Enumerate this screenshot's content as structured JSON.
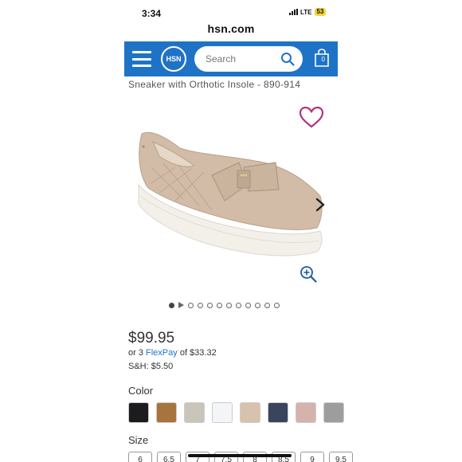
{
  "status": {
    "time": "3:34",
    "network": "LTE",
    "battery": "53"
  },
  "browser": {
    "url": "hsn.com"
  },
  "header": {
    "logo_text": "HSN",
    "search_placeholder": "Search",
    "bag_count": "0"
  },
  "product": {
    "title": "Sneaker with Orthotic Insole  - 890-914",
    "price": "$99.95",
    "flexpay_prefix": "or 3 ",
    "flexpay_link": "FlexPay",
    "flexpay_suffix": " of $33.32",
    "shipping": "S&H: $5.50"
  },
  "gallery": {
    "current_slide": 1,
    "total_slides": 12
  },
  "options": {
    "color_label": "Color",
    "colors": [
      "#1c1c1e",
      "#a8743e",
      "#c9c5ba",
      "#f4f5f8",
      "#d8c2ad",
      "#39455d",
      "#d6b2ad",
      "#9d9d9d"
    ],
    "size_label": "Size",
    "sizes": [
      "6",
      "6.5",
      "7",
      "7.5",
      "8",
      "8.5",
      "9",
      "9.5"
    ]
  },
  "colors": {
    "brand_blue": "#1f73c7",
    "heart": "#b2327c"
  }
}
